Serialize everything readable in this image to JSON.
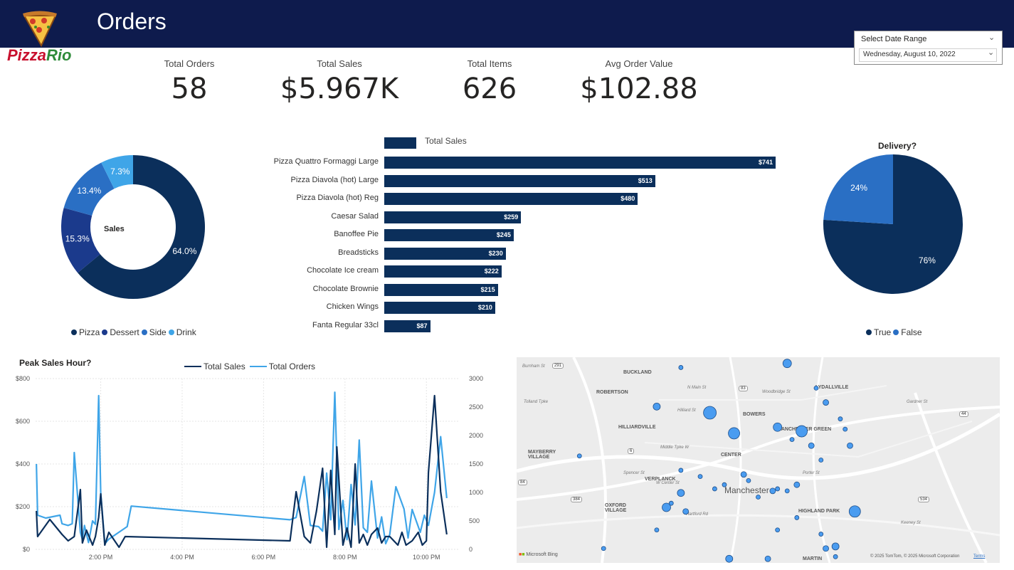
{
  "header": {
    "title": "Orders",
    "logo_text_a": "Pizza",
    "logo_text_b": "Rio"
  },
  "kpis": [
    {
      "label": "Total Orders",
      "value": "58"
    },
    {
      "label": "Total Sales",
      "value": "$5.967K"
    },
    {
      "label": "Total Items",
      "value": "626"
    },
    {
      "label": "Avg Order Value",
      "value": "$102.88"
    }
  ],
  "slicer": {
    "title": "Select Date Range",
    "value": "Wednesday, August 10, 2022"
  },
  "colors": {
    "navy": "#0b2f5b",
    "blue1": "#1b3a8c",
    "blue2": "#2a6fc4",
    "blue3": "#3fa5e8",
    "header": "#0e1b4d"
  },
  "chart_data": [
    {
      "type": "pie",
      "variant": "donut",
      "title": "Sales",
      "categories": [
        "Pizza",
        "Dessert",
        "Side",
        "Drink"
      ],
      "values": [
        64.0,
        15.3,
        13.4,
        7.3
      ],
      "labels": [
        "64.0%",
        "15.3%",
        "13.4%",
        "7.3%"
      ],
      "colors": [
        "#0b2f5b",
        "#1b3a8c",
        "#2a6fc4",
        "#3fa5e8"
      ],
      "legend": "bottom"
    },
    {
      "type": "bar",
      "orientation": "horizontal",
      "series_name": "Total Sales",
      "categories": [
        "Pizza Quattro Formaggi Large",
        "Pizza Diavola (hot) Large",
        "Pizza Diavola (hot) Reg",
        "Caesar Salad",
        "Banoffee Pie",
        "Breadsticks",
        "Chocolate Ice cream",
        "Chocolate Brownie",
        "Chicken Wings",
        "Fanta Regular 33cl"
      ],
      "values": [
        741,
        513,
        480,
        259,
        245,
        230,
        222,
        215,
        210,
        87
      ],
      "labels": [
        "$741",
        "$513",
        "$480",
        "$259",
        "$245",
        "$230",
        "$222",
        "$215",
        "$210",
        "$87"
      ],
      "legend": "top-left"
    },
    {
      "type": "pie",
      "title": "Delivery?",
      "categories": [
        "True",
        "False"
      ],
      "values": [
        76,
        24
      ],
      "labels": [
        "76%",
        "24%"
      ],
      "colors": [
        "#0b2f5b",
        "#2a6fc4"
      ],
      "legend": "bottom"
    },
    {
      "type": "line",
      "title": "Peak Sales Hour?",
      "x_ticks": [
        "2:00 PM",
        "4:00 PM",
        "6:00 PM",
        "8:00 PM",
        "10:00 PM"
      ],
      "y_left_ticks": [
        "$800",
        "$600",
        "$400",
        "$200",
        "$0"
      ],
      "y_right_ticks": [
        "3000",
        "2500",
        "2000",
        "1500",
        "1000",
        "500",
        "0"
      ],
      "ylim_left": [
        0,
        800
      ],
      "ylim_right": [
        0,
        3000
      ],
      "xlim_hours": [
        12.4,
        22.8
      ],
      "grid": true,
      "legend": "top-center",
      "series": [
        {
          "name": "Total Sales",
          "axis": "left",
          "color": "#0b2f5b",
          "x": [
            12.42,
            12.45,
            12.75,
            13.05,
            13.2,
            13.35,
            13.5,
            13.55,
            13.65,
            13.8,
            13.87,
            13.95,
            14.0,
            14.1,
            14.2,
            14.45,
            14.6,
            18.65,
            18.8,
            19.0,
            19.15,
            19.3,
            19.45,
            19.55,
            19.65,
            19.75,
            19.8,
            19.95,
            20.05,
            20.15,
            20.25,
            20.35,
            20.45,
            20.55,
            20.65,
            20.8,
            20.9,
            21.0,
            21.1,
            21.3,
            21.4,
            21.5,
            21.65,
            21.8,
            21.9,
            22.0,
            22.05,
            22.2,
            22.35,
            22.5
          ],
          "y": [
            180,
            60,
            140,
            70,
            40,
            60,
            280,
            30,
            90,
            20,
            60,
            150,
            260,
            20,
            80,
            10,
            60,
            40,
            270,
            60,
            30,
            180,
            380,
            10,
            370,
            70,
            480,
            20,
            100,
            10,
            400,
            30,
            70,
            20,
            70,
            100,
            30,
            60,
            60,
            20,
            80,
            20,
            40,
            80,
            20,
            40,
            360,
            720,
            270,
            70
          ]
        },
        {
          "name": "Total Orders",
          "axis": "right",
          "color": "#3fa5e8",
          "x": [
            12.42,
            12.45,
            12.65,
            13.0,
            13.05,
            13.2,
            13.3,
            13.35,
            13.5,
            13.55,
            13.6,
            13.7,
            13.8,
            13.87,
            13.95,
            14.0,
            14.1,
            14.2,
            14.65,
            14.75,
            18.65,
            18.8,
            19.0,
            19.15,
            19.35,
            19.45,
            19.55,
            19.65,
            19.75,
            19.85,
            19.95,
            20.05,
            20.15,
            20.25,
            20.35,
            20.45,
            20.55,
            20.65,
            20.8,
            20.9,
            21.0,
            21.1,
            21.25,
            21.45,
            21.55,
            21.65,
            21.85,
            21.95,
            22.05,
            22.2,
            22.35,
            22.5
          ],
          "y": [
            1500,
            600,
            550,
            600,
            450,
            420,
            450,
            1700,
            300,
            170,
            420,
            120,
            500,
            440,
            2700,
            1000,
            100,
            180,
            400,
            760,
            520,
            560,
            1280,
            420,
            400,
            320,
            1340,
            520,
            2760,
            350,
            860,
            170,
            1140,
            430,
            1920,
            380,
            300,
            1200,
            200,
            570,
            100,
            260,
            1100,
            710,
            200,
            700,
            300,
            600,
            420,
            1000,
            1980,
            900
          ]
        }
      ]
    }
  ],
  "map": {
    "brand": "Microsoft Bing",
    "copyright": "© 2025 TomTom, © 2025 Microsoft Corporation",
    "terms": "Terms",
    "city_label": "Manchester",
    "area_labels": [
      "BUCKLAND",
      "ROBERTSON",
      "HILLIARDVILLE",
      "MAYBERRY VILLAGE",
      "VERPLANCK",
      "OXFORD VILLAGE",
      "BOWERS",
      "MANCHESTER GREEN",
      "LYDALLVILLE",
      "CENTER",
      "HIGHLAND PARK",
      "MARTIN"
    ],
    "street_labels": [
      "Burnham St",
      "Tolland Tpke",
      "N Main St",
      "Woodbridge St",
      "Hilliard St",
      "Middle Tpke W",
      "W Center St",
      "Hartford Rd",
      "Porter St",
      "Spencer St",
      "Keeney St",
      "Gardner St"
    ],
    "route_shields": [
      "291",
      "83",
      "6",
      "84",
      "384",
      "44",
      "534"
    ],
    "markers": [
      {
        "cx": 0.34,
        "cy": 0.05,
        "r": 3
      },
      {
        "cx": 0.56,
        "cy": 0.03,
        "r": 6
      },
      {
        "cx": 0.62,
        "cy": 0.15,
        "r": 3
      },
      {
        "cx": 0.29,
        "cy": 0.24,
        "r": 5
      },
      {
        "cx": 0.4,
        "cy": 0.27,
        "r": 9
      },
      {
        "cx": 0.45,
        "cy": 0.37,
        "r": 8
      },
      {
        "cx": 0.54,
        "cy": 0.34,
        "r": 6
      },
      {
        "cx": 0.59,
        "cy": 0.36,
        "r": 8
      },
      {
        "cx": 0.64,
        "cy": 0.22,
        "r": 4
      },
      {
        "cx": 0.67,
        "cy": 0.3,
        "r": 3
      },
      {
        "cx": 0.68,
        "cy": 0.35,
        "r": 3
      },
      {
        "cx": 0.69,
        "cy": 0.43,
        "r": 4
      },
      {
        "cx": 0.61,
        "cy": 0.43,
        "r": 4
      },
      {
        "cx": 0.57,
        "cy": 0.4,
        "r": 3
      },
      {
        "cx": 0.13,
        "cy": 0.48,
        "r": 3
      },
      {
        "cx": 0.34,
        "cy": 0.55,
        "r": 3
      },
      {
        "cx": 0.38,
        "cy": 0.58,
        "r": 3
      },
      {
        "cx": 0.43,
        "cy": 0.62,
        "r": 3
      },
      {
        "cx": 0.47,
        "cy": 0.57,
        "r": 4
      },
      {
        "cx": 0.48,
        "cy": 0.6,
        "r": 3
      },
      {
        "cx": 0.34,
        "cy": 0.66,
        "r": 5
      },
      {
        "cx": 0.32,
        "cy": 0.71,
        "r": 3
      },
      {
        "cx": 0.31,
        "cy": 0.73,
        "r": 6
      },
      {
        "cx": 0.35,
        "cy": 0.75,
        "r": 4
      },
      {
        "cx": 0.41,
        "cy": 0.64,
        "r": 3
      },
      {
        "cx": 0.53,
        "cy": 0.65,
        "r": 4
      },
      {
        "cx": 0.54,
        "cy": 0.64,
        "r": 3
      },
      {
        "cx": 0.56,
        "cy": 0.65,
        "r": 3
      },
      {
        "cx": 0.58,
        "cy": 0.62,
        "r": 4
      },
      {
        "cx": 0.5,
        "cy": 0.68,
        "r": 3
      },
      {
        "cx": 0.63,
        "cy": 0.5,
        "r": 3
      },
      {
        "cx": 0.58,
        "cy": 0.78,
        "r": 3
      },
      {
        "cx": 0.7,
        "cy": 0.75,
        "r": 8
      },
      {
        "cx": 0.29,
        "cy": 0.84,
        "r": 3
      },
      {
        "cx": 0.18,
        "cy": 0.93,
        "r": 3
      },
      {
        "cx": 0.54,
        "cy": 0.84,
        "r": 3
      },
      {
        "cx": 0.63,
        "cy": 0.86,
        "r": 3
      },
      {
        "cx": 0.64,
        "cy": 0.93,
        "r": 4
      },
      {
        "cx": 0.66,
        "cy": 0.92,
        "r": 5
      },
      {
        "cx": 0.44,
        "cy": 0.98,
        "r": 5
      },
      {
        "cx": 0.52,
        "cy": 0.98,
        "r": 4
      },
      {
        "cx": 0.66,
        "cy": 0.97,
        "r": 3
      }
    ]
  }
}
